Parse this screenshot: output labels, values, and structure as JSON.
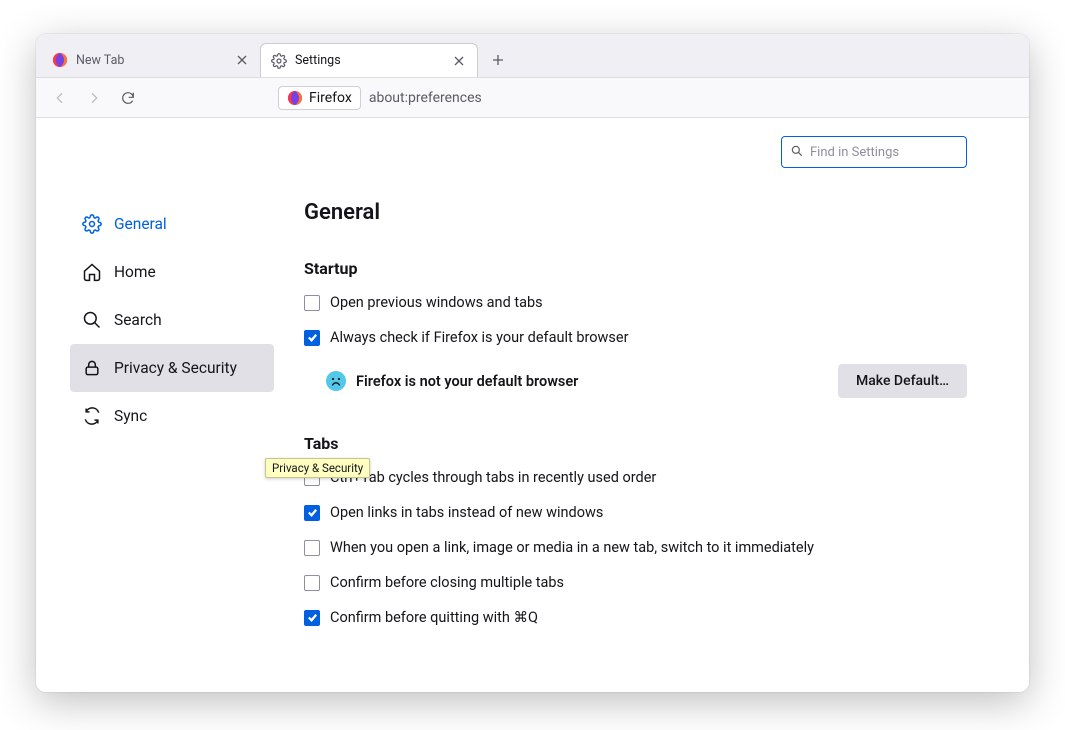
{
  "tabs": [
    {
      "title": "New Tab",
      "active": false
    },
    {
      "title": "Settings",
      "active": true
    }
  ],
  "toolbar": {
    "identity_brand": "Firefox",
    "url": "about:preferences"
  },
  "search": {
    "placeholder": "Find in Settings"
  },
  "sidebar": {
    "items": [
      {
        "label": "General",
        "icon": "gear",
        "active": true
      },
      {
        "label": "Home",
        "icon": "home"
      },
      {
        "label": "Search",
        "icon": "search"
      },
      {
        "label": "Privacy & Security",
        "icon": "lock",
        "hover": true
      },
      {
        "label": "Sync",
        "icon": "sync"
      }
    ],
    "tooltip": "Privacy & Security"
  },
  "main": {
    "heading": "General",
    "startup": {
      "title": "Startup",
      "open_previous": {
        "label": "Open previous windows and tabs",
        "checked": false
      },
      "always_check": {
        "label": "Always check if Firefox is your default browser",
        "checked": true
      },
      "default_status": "Firefox is not your default browser",
      "make_default_btn": "Make Default…"
    },
    "tabs_section": {
      "title": "Tabs",
      "ctrl_tab": {
        "label": "Ctrl+Tab cycles through tabs in recently used order",
        "checked": false
      },
      "open_links": {
        "label": "Open links in tabs instead of new windows",
        "checked": true
      },
      "switch_new": {
        "label": "When you open a link, image or media in a new tab, switch to it immediately",
        "checked": false
      },
      "confirm_close": {
        "label": "Confirm before closing multiple tabs",
        "checked": false
      },
      "confirm_quit": {
        "label": "Confirm before quitting with ⌘Q",
        "checked": true
      }
    }
  }
}
